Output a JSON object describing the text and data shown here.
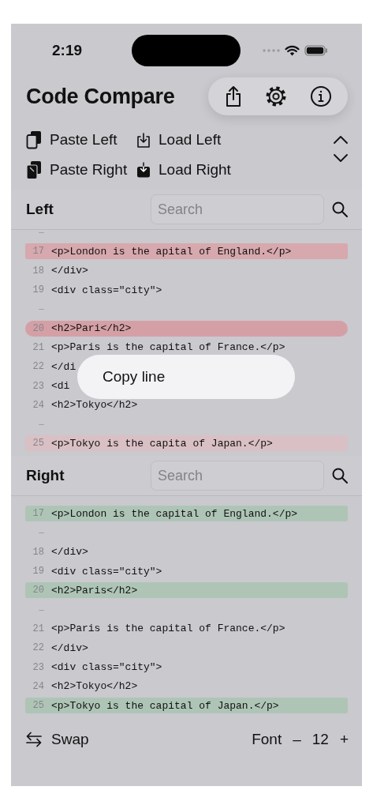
{
  "status_bar": {
    "time": "2:19"
  },
  "app": {
    "title": "Code Compare"
  },
  "actions": [
    {
      "label": "Paste Left"
    },
    {
      "label": "Load Left"
    },
    {
      "label": "Paste Right"
    },
    {
      "label": "Load Right"
    }
  ],
  "panes": [
    {
      "title": "Left",
      "search": {
        "placeholder": "Search"
      },
      "rows": [
        {
          "kind": "gap",
          "mark": "–"
        },
        {
          "kind": "line",
          "number": "17",
          "code": "<p>London is the apital of England.</p>",
          "color": "#d7a8ad",
          "selected": false
        },
        {
          "kind": "line",
          "number": "18",
          "code": "</div>",
          "selected": false
        },
        {
          "kind": "line",
          "number": "19",
          "code": "<div class=\"city\">",
          "selected": false
        },
        {
          "kind": "gap",
          "mark": "–"
        },
        {
          "kind": "line",
          "number": "20",
          "code": "<h2>Pari</h2>",
          "selected": true
        },
        {
          "kind": "line",
          "number": "21",
          "code": "<p>Paris is the capital of France.</p>",
          "selected": false
        },
        {
          "kind": "line",
          "number": "22",
          "code": "</di",
          "selected": false
        },
        {
          "kind": "line",
          "number": "23",
          "code": "<di",
          "selected": false
        },
        {
          "kind": "line",
          "number": "24",
          "code": "<h2>Tokyo</h2>",
          "selected": false
        },
        {
          "kind": "gap",
          "mark": "–"
        },
        {
          "kind": "line",
          "number": "25",
          "code": "<p>Tokyo is the capita of Japan.</p>",
          "color": "#d9c0c4",
          "selected": false
        }
      ]
    },
    {
      "title": "Right",
      "search": {
        "placeholder": "Search"
      },
      "rows": [
        {
          "kind": "line",
          "number": "17",
          "code": "<p>London is the capital of England.</p>",
          "color": "#aec5b6",
          "selected": false
        },
        {
          "kind": "gap",
          "mark": "–"
        },
        {
          "kind": "line",
          "number": "18",
          "code": "</div>",
          "selected": false
        },
        {
          "kind": "line",
          "number": "19",
          "code": "<div class=\"city\">",
          "selected": false
        },
        {
          "kind": "line",
          "number": "20",
          "code": "<h2>Paris</h2>",
          "color": "#aec5b6",
          "selected": false
        },
        {
          "kind": "gap",
          "mark": "–"
        },
        {
          "kind": "line",
          "number": "21",
          "code": "<p>Paris is the capital of France.</p>",
          "selected": false
        },
        {
          "kind": "line",
          "number": "22",
          "code": "</div>",
          "selected": false
        },
        {
          "kind": "line",
          "number": "23",
          "code": "<div class=\"city\">",
          "selected": false
        },
        {
          "kind": "line",
          "number": "24",
          "code": "<h2>Tokyo</h2>",
          "selected": false
        },
        {
          "kind": "line",
          "number": "25",
          "code": "<p>Tokyo is the capital of Japan.</p>",
          "color": "#aec5b6",
          "selected": false
        }
      ]
    }
  ],
  "context_menu": {
    "items": [
      "Copy line"
    ]
  },
  "bottom_bar": {
    "swap": "Swap",
    "font_label": "Font",
    "decrease": "–",
    "size": "12",
    "increase": "+"
  }
}
